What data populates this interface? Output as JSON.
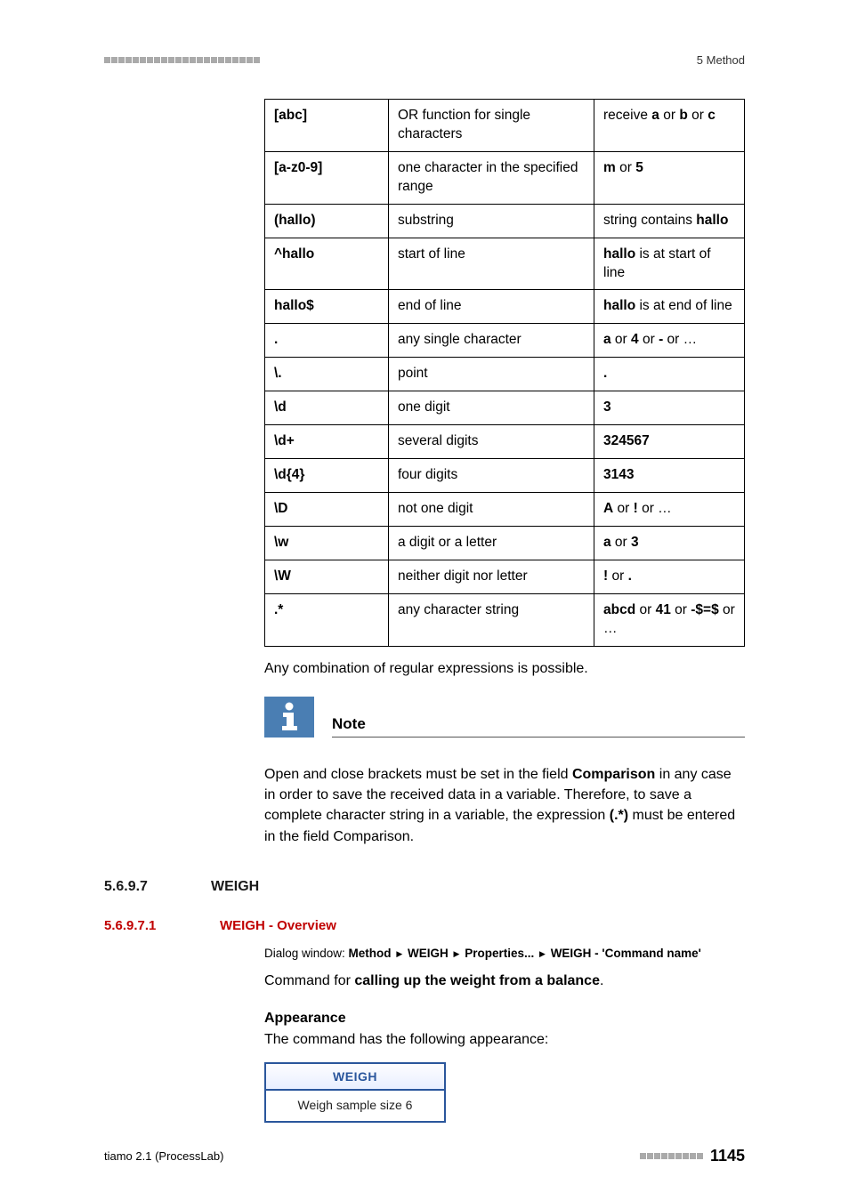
{
  "header": {
    "right": "5 Method"
  },
  "table_rows": [
    {
      "c1": "[abc]",
      "c2": "OR function for single characters",
      "c3": "receive <b>a</b> or <b>b</b> or <b>c</b>"
    },
    {
      "c1": "[a-z0-9]",
      "c2": "one character in the specified range",
      "c3": "<b>m</b> or <b>5</b>"
    },
    {
      "c1": "(hallo)",
      "c2": "substring",
      "c3": "string contains <b>hallo</b>"
    },
    {
      "c1": "^hallo",
      "c2": "start of line",
      "c3": "<b>hallo</b> is at start of line"
    },
    {
      "c1": "hallo$",
      "c2": "end of line",
      "c3": "<b>hallo</b> is at end of line"
    },
    {
      "c1": ".",
      "c2": "any single character",
      "c3": "<b>a</b> or <b>4</b> or <b>-</b> or …"
    },
    {
      "c1": "\\.",
      "c2": "point",
      "c3": "<b>.</b>"
    },
    {
      "c1": "\\d",
      "c2": "one digit",
      "c3": "<b>3</b>"
    },
    {
      "c1": "\\d+",
      "c2": "several digits",
      "c3": "<b>324567</b>"
    },
    {
      "c1": "\\d{4}",
      "c2": "four digits",
      "c3": "<b>3143</b>"
    },
    {
      "c1": "\\D",
      "c2": "not one digit",
      "c3": "<b>A</b> or <b>!</b> or …"
    },
    {
      "c1": "\\w",
      "c2": "a digit or a letter",
      "c3": "<b>a</b> or <b>3</b>"
    },
    {
      "c1": "\\W",
      "c2": "neither digit nor letter",
      "c3": "<b>!</b> or <b>.</b>"
    },
    {
      "c1": ".*",
      "c2": "any character string",
      "c3": "<b>abcd</b> or <b>41</b> or <b>-$=$</b> or …"
    }
  ],
  "after_table": "Any combination of regular expressions is possible.",
  "note": {
    "title": "Note",
    "body": "Open and close brackets must be set in the field <b>Comparison</b> in any case in order to save the received data in a variable. Therefore, to save a complete character string in a variable, the expression <b>(.*)</b> must be entered in the field Comparison."
  },
  "section": {
    "num": "5.6.9.7",
    "title": "WEIGH"
  },
  "subsection": {
    "num": "5.6.9.7.1",
    "title": "WEIGH - Overview"
  },
  "dialog": {
    "prefix": "Dialog window: ",
    "parts": [
      "Method",
      "WEIGH",
      "Properties...",
      "WEIGH - 'Command name'"
    ]
  },
  "cmd_line": "Command for <b>calling up the weight from a balance</b>.",
  "appearance": {
    "title": "Appearance",
    "text": "The command has the following appearance:"
  },
  "weigh_box": {
    "head": "WEIGH",
    "body": "Weigh sample size 6"
  },
  "footer": {
    "left": "tiamo 2.1 (ProcessLab)",
    "page": "1145"
  }
}
